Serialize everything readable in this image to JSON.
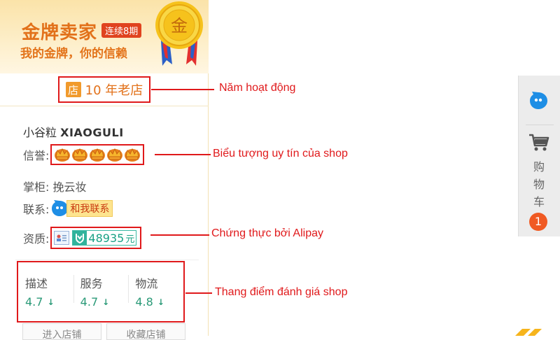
{
  "banner": {
    "title": "金牌卖家",
    "streak": "连续8期",
    "slogan": "我的金牌，你的信赖",
    "medal_char": "金"
  },
  "shop": {
    "store_icon": "店",
    "years_text": "10 年老店",
    "name_prefix": "小谷粒",
    "name_main": "XIAOGULI",
    "credit_label": "信誉:",
    "credit_crowns": 5,
    "keeper_label": "掌柜:",
    "keeper_name": "挽云妆",
    "contact_label": "联系:",
    "contact_button": "和我联系",
    "cert_label": "资质:",
    "deposit_amount": "48935",
    "deposit_unit": "元"
  },
  "ratings": [
    {
      "label": "描述",
      "value": "4.7"
    },
    {
      "label": "服务",
      "value": "4.7"
    },
    {
      "label": "物流",
      "value": "4.8"
    }
  ],
  "bottom_buttons": {
    "enter_shop": "进入店铺",
    "favorite_shop": "收藏店铺"
  },
  "annotations": {
    "years": "Năm hoạt động",
    "credit": "Biểu tượng uy tín của shop",
    "alipay": "Chứng thực bởi Alipay",
    "rating": "Thang điểm đánh giá shop"
  },
  "right_bar": {
    "cart_label": "购物车",
    "cart_count": "1"
  },
  "colors": {
    "annotation_red": "#e0191b",
    "gold_orange": "#e2711a",
    "rating_green": "#2b9a78",
    "cart_badge": "#f05a23"
  },
  "icons": [
    "gold-medal-icon",
    "store-icon",
    "crown-icon",
    "wangwang-chat-icon",
    "id-card-icon",
    "alipay-shield-icon",
    "down-arrow-icon",
    "cart-icon"
  ]
}
